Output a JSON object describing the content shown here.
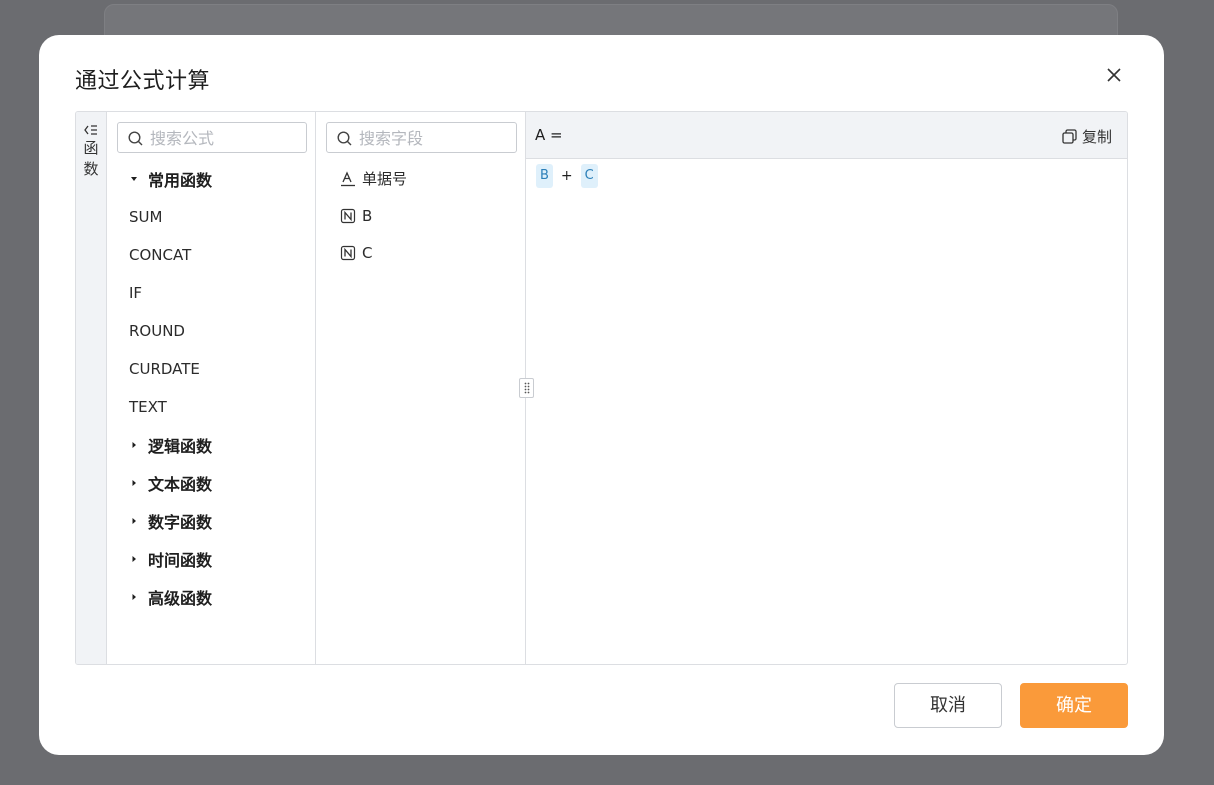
{
  "dialog": {
    "title": "通过公式计算",
    "close_icon": "close-icon"
  },
  "sidebar_tab": {
    "icon": "collapse-panel-icon",
    "label": "函数"
  },
  "functions": {
    "search_placeholder": "搜索公式",
    "groups": [
      {
        "label": "常用函数",
        "expanded": true,
        "items": [
          "SUM",
          "CONCAT",
          "IF",
          "ROUND",
          "CURDATE",
          "TEXT"
        ]
      },
      {
        "label": "逻辑函数",
        "expanded": false
      },
      {
        "label": "文本函数",
        "expanded": false
      },
      {
        "label": "数字函数",
        "expanded": false
      },
      {
        "label": "时间函数",
        "expanded": false
      },
      {
        "label": "高级函数",
        "expanded": false
      }
    ]
  },
  "fields": {
    "search_placeholder": "搜索字段",
    "items": [
      {
        "label": "单据号",
        "icon": "text-field-icon"
      },
      {
        "label": "B",
        "icon": "number-field-icon"
      },
      {
        "label": "C",
        "icon": "number-field-icon"
      }
    ]
  },
  "formula": {
    "label": "A =",
    "copy_label": "复制",
    "tokens": [
      "B",
      "+",
      "C"
    ]
  },
  "footer": {
    "cancel_label": "取消",
    "ok_label": "确定"
  },
  "colors": {
    "primary": "#fa9a3a",
    "token_bg": "#dff0fb",
    "token_text": "#2b7fb8",
    "header_bg": "#f1f3f6"
  }
}
